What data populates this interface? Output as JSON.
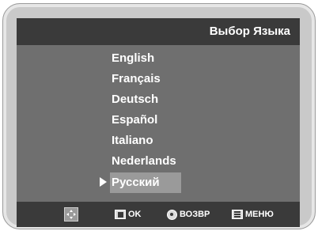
{
  "title": "Выбор Языка",
  "languages": [
    {
      "label": "English",
      "selected": false
    },
    {
      "label": "Français",
      "selected": false
    },
    {
      "label": "Deutsch",
      "selected": false
    },
    {
      "label": "Español",
      "selected": false
    },
    {
      "label": "Italiano",
      "selected": false
    },
    {
      "label": "Nederlands",
      "selected": false
    },
    {
      "label": "Русский",
      "selected": true
    }
  ],
  "footer": {
    "nav_icon": "dpad-icon",
    "ok_label": "OK",
    "back_label": "ВОЗВР",
    "menu_label": "МЕНЮ"
  },
  "colors": {
    "panel": "#6f6f6f",
    "bar": "#3a3a3a",
    "highlight": "#9a9a9a",
    "text": "#ffffff"
  }
}
